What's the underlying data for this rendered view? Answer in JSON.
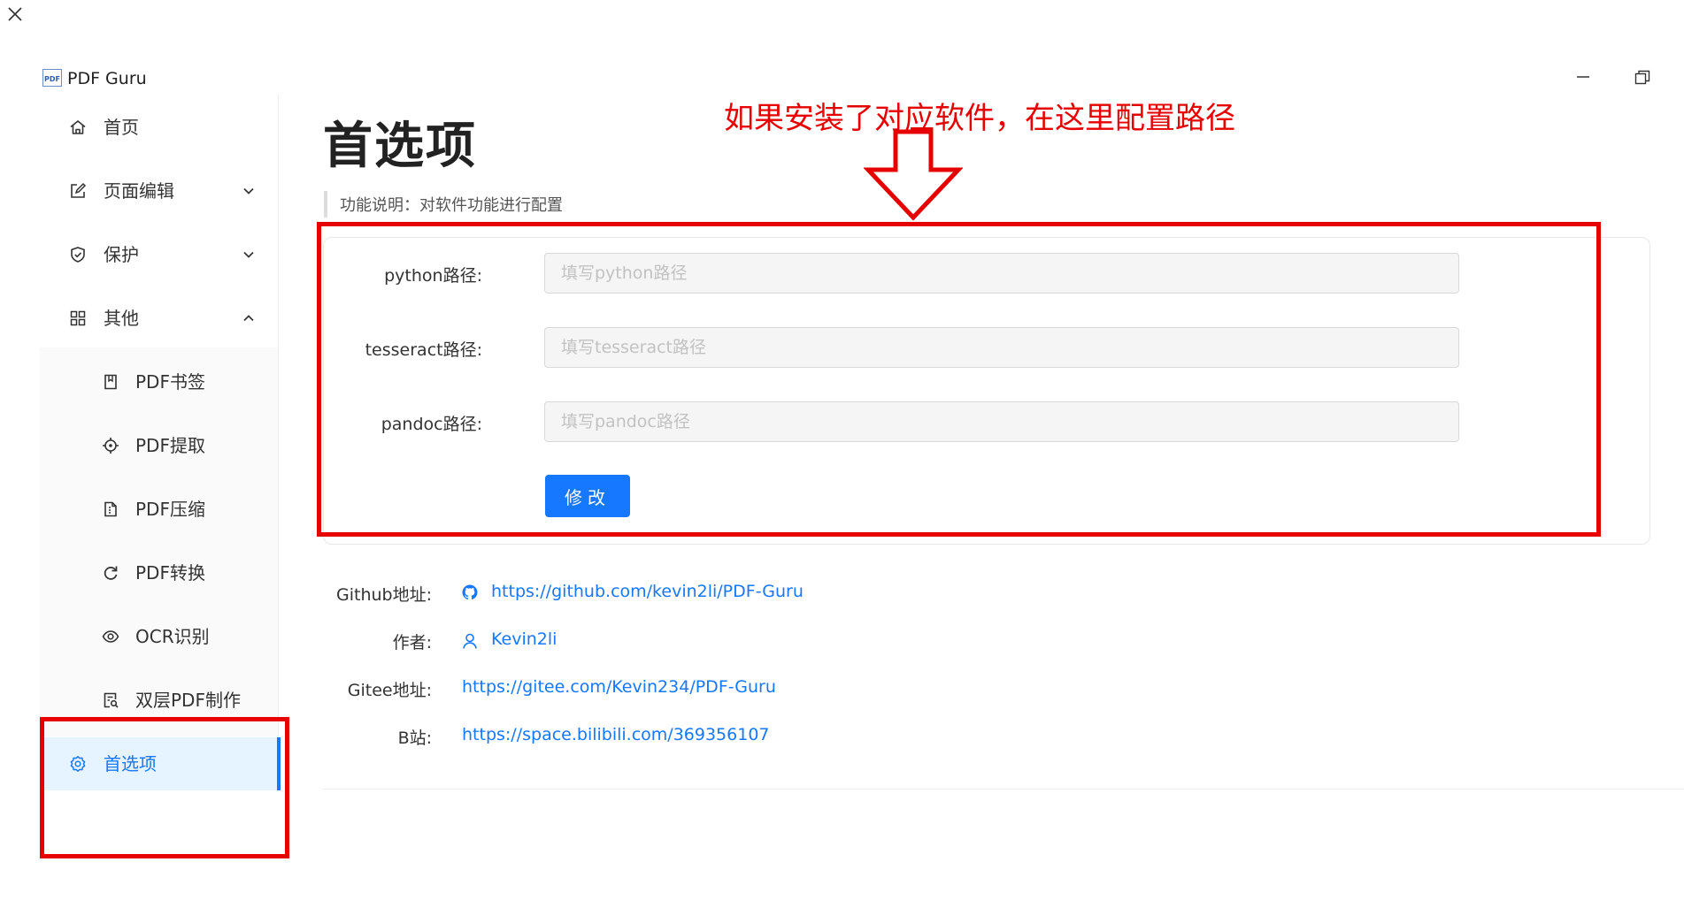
{
  "app": {
    "title": "PDF Guru",
    "logo_text": "PDF"
  },
  "window_controls": {
    "close": "close-icon",
    "minimize": "minimize-icon",
    "restore": "restore-icon"
  },
  "sidebar": {
    "items": [
      {
        "label": "首页",
        "icon": "home-icon"
      },
      {
        "label": "页面编辑",
        "icon": "edit-icon",
        "chevron": "down"
      },
      {
        "label": "保护",
        "icon": "shield-icon",
        "chevron": "down"
      },
      {
        "label": "其他",
        "icon": "apps-icon",
        "chevron": "up"
      },
      {
        "label": "PDF书签",
        "icon": "bookmark-icon"
      },
      {
        "label": "PDF提取",
        "icon": "aim-icon"
      },
      {
        "label": "PDF压缩",
        "icon": "file-icon"
      },
      {
        "label": "PDF转换",
        "icon": "refresh-icon"
      },
      {
        "label": "OCR识别",
        "icon": "eye-icon"
      },
      {
        "label": "双层PDF制作",
        "icon": "file-search-icon"
      },
      {
        "label": "首选项",
        "icon": "gear-icon",
        "active": true
      }
    ]
  },
  "main": {
    "title": "首选项",
    "description": "功能说明：对软件功能进行配置",
    "form": {
      "fields": [
        {
          "label": "python路径:",
          "placeholder": "填写python路径",
          "value": ""
        },
        {
          "label": "tesseract路径:",
          "placeholder": "填写tesseract路径",
          "value": ""
        },
        {
          "label": "pandoc路径:",
          "placeholder": "填写pandoc路径",
          "value": ""
        }
      ],
      "submit_label": "修改"
    },
    "info": [
      {
        "label": "Github地址:",
        "value": "https://github.com/kevin2li/PDF-Guru",
        "icon": "github-icon"
      },
      {
        "label": "作者:",
        "value": "Kevin2li",
        "icon": "user-icon"
      },
      {
        "label": "Gitee地址:",
        "value": "https://gitee.com/Kevin234/PDF-Guru"
      },
      {
        "label": "B站:",
        "value": "https://space.bilibili.com/369356107"
      }
    ]
  },
  "annotation": {
    "text": "如果安装了对应软件，在这里配置路径",
    "color": "#e60000"
  },
  "colors": {
    "accent": "#1677ff",
    "annotation": "#e60000",
    "active_bg": "#e6f4ff"
  }
}
